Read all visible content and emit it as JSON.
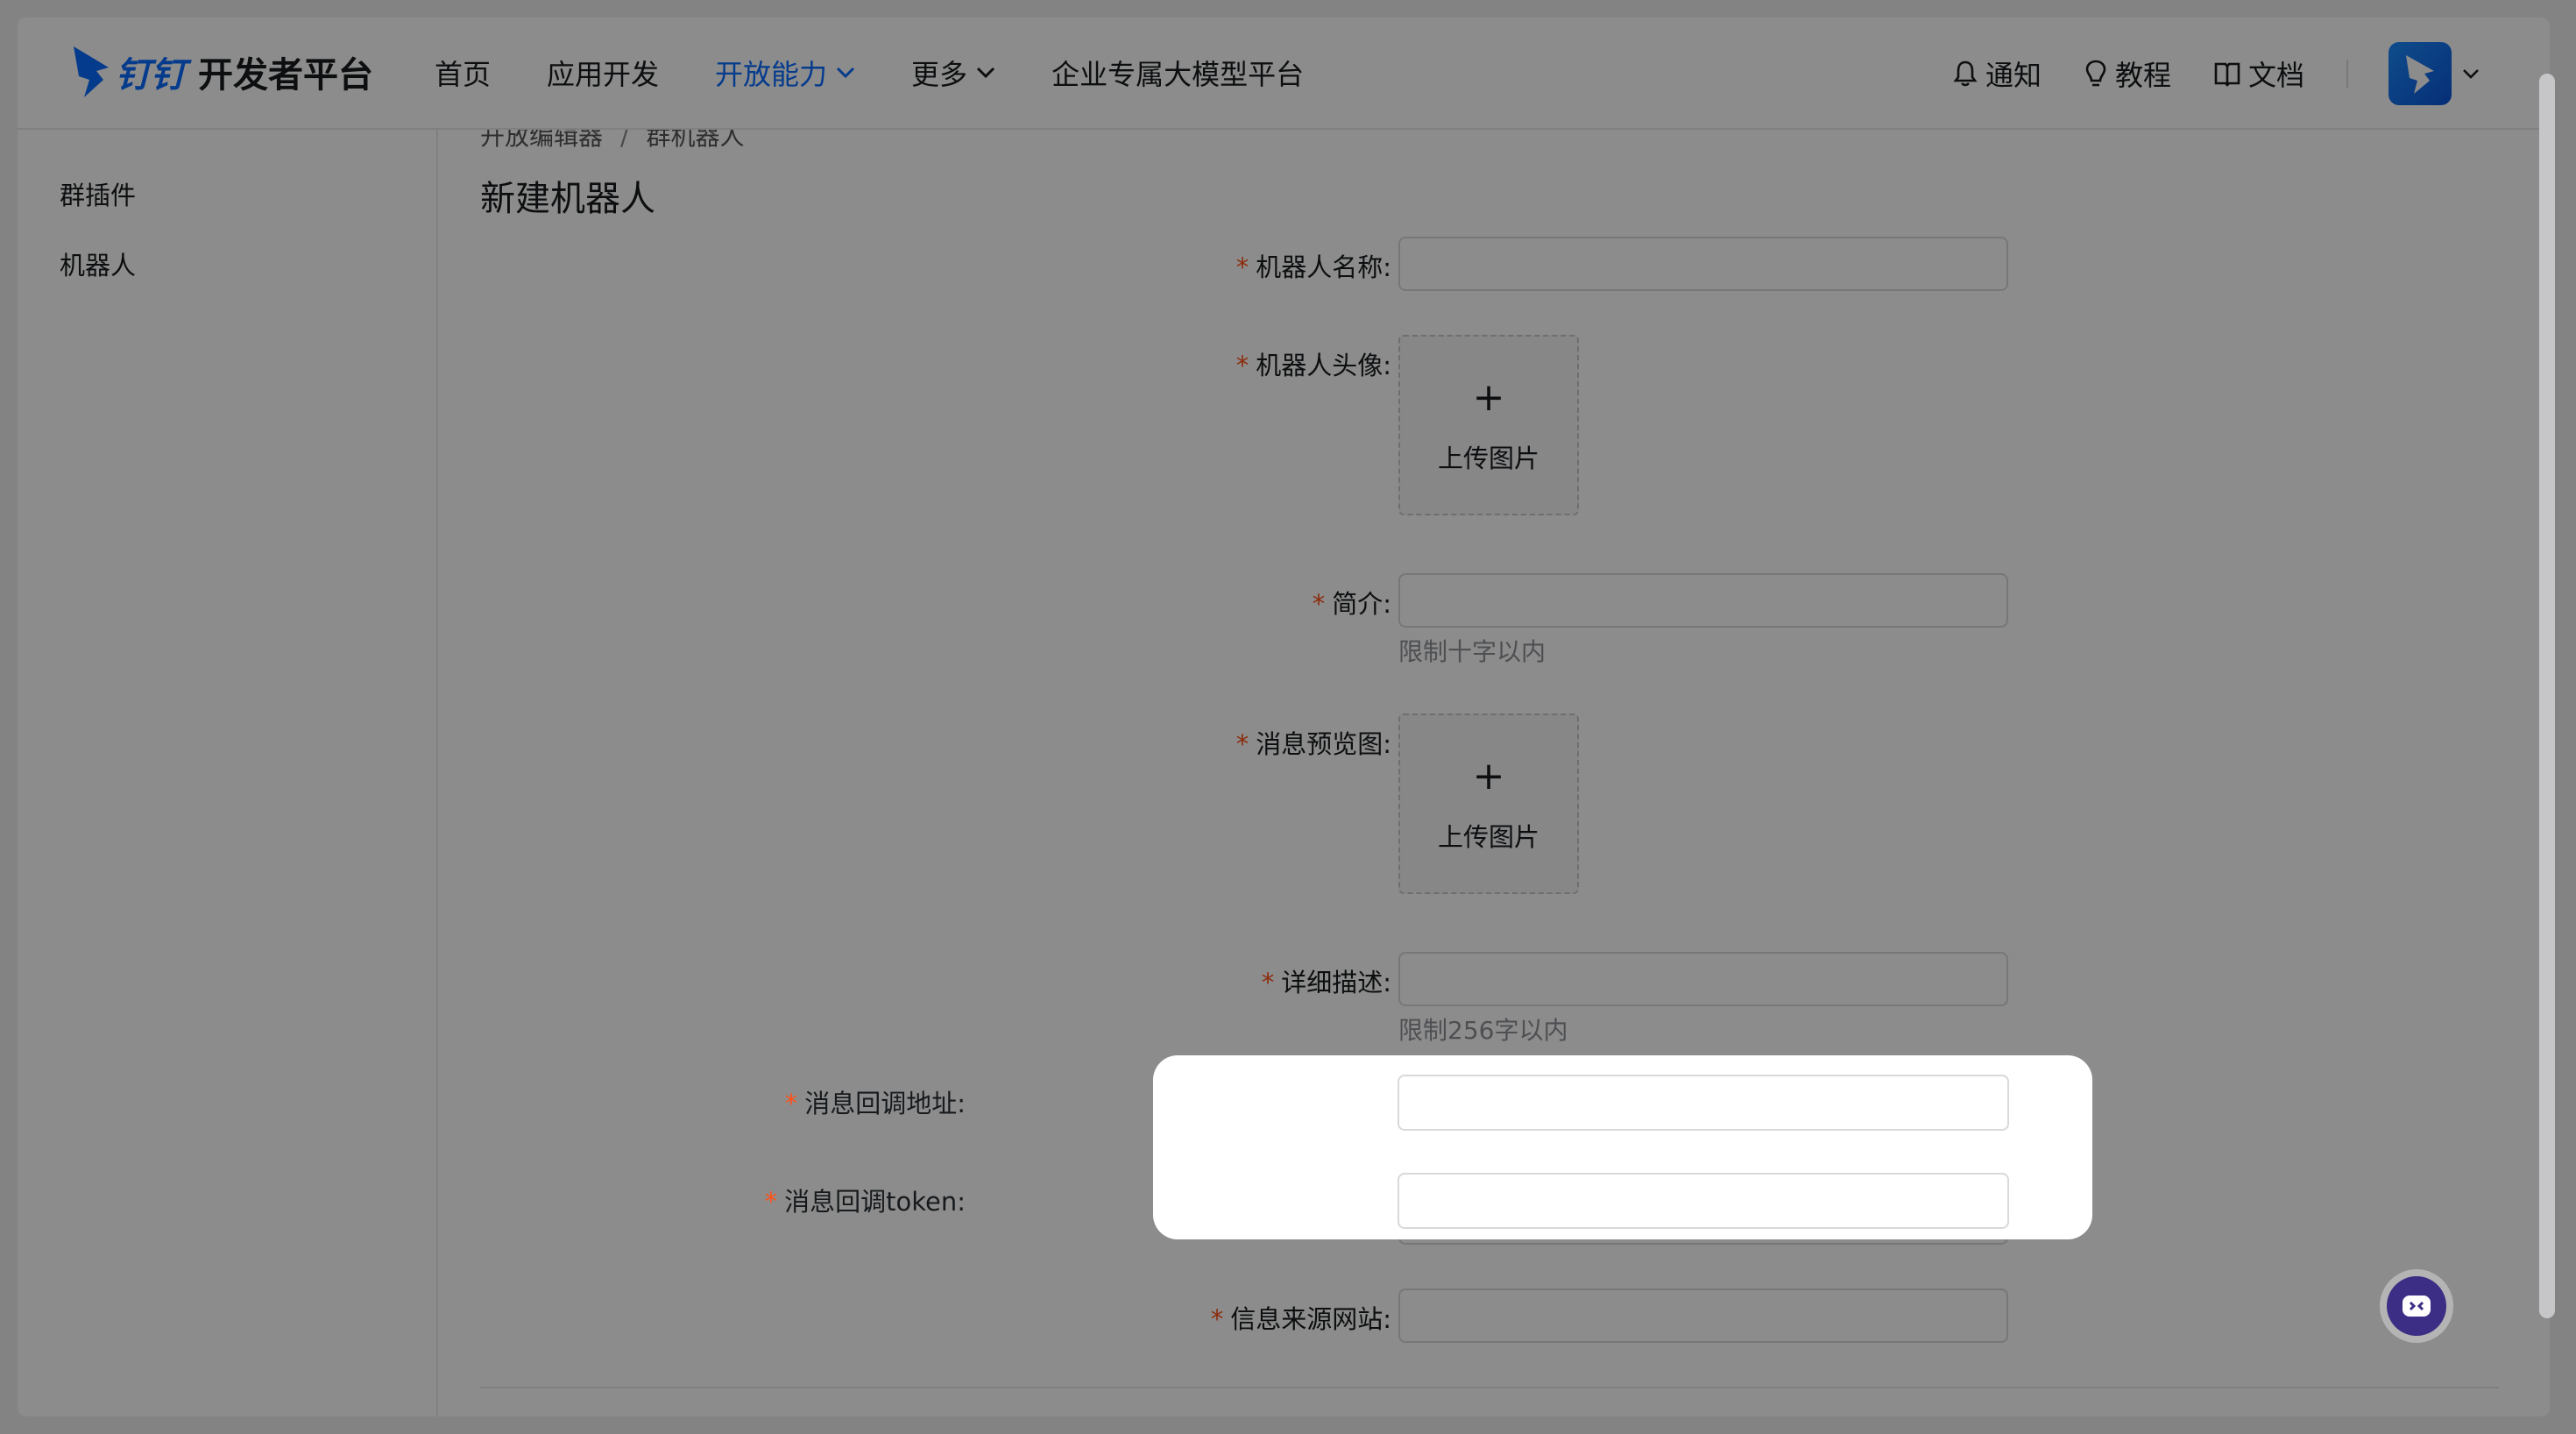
{
  "header": {
    "logo_brand": "钉钉",
    "logo_suffix": "开发者平台",
    "nav": [
      {
        "label": "首页"
      },
      {
        "label": "应用开发"
      },
      {
        "label": "开放能力"
      },
      {
        "label": "更多"
      },
      {
        "label": "企业专属大模型平台"
      }
    ],
    "tools": {
      "notify": "通知",
      "tutorial": "教程",
      "docs": "文档"
    }
  },
  "sidebar": {
    "items": [
      {
        "label": "群插件"
      },
      {
        "label": "机器人"
      }
    ]
  },
  "breadcrumb": {
    "parent": "开放编辑器",
    "current": "群机器人"
  },
  "page_title": "新建机器人",
  "form": {
    "name_label": "机器人名称:",
    "avatar_label": "机器人头像:",
    "intro_label": "简介:",
    "intro_hint": "限制十字以内",
    "preview_label": "消息预览图:",
    "desc_label": "详细描述:",
    "desc_hint": "限制256字以内",
    "callback_url_label": "消息回调地址:",
    "callback_token_label": "消息回调token:",
    "source_site_label": "信息来源网站:",
    "upload_label": "上传图片",
    "upload_plus": "+",
    "required_mark": "*"
  },
  "colors": {
    "brand": "#0a6cff",
    "required": "#ff5219",
    "overlay": "rgba(0,0,0,0.45)",
    "widget": "#3c2d85"
  }
}
